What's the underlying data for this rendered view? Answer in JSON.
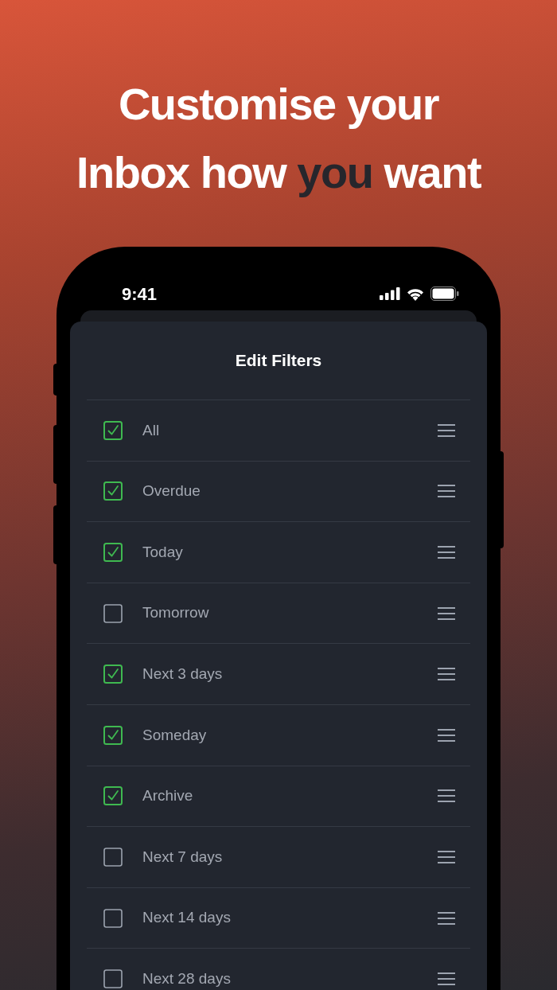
{
  "headline": {
    "line_1": "Customise your",
    "line_2": [
      {
        "text": "Inbox how ",
        "highlight": false
      },
      {
        "text": "you",
        "highlight": true
      },
      {
        "text": " want",
        "highlight": false
      }
    ]
  },
  "status_bar": {
    "time": "9:41"
  },
  "sheet": {
    "title": "Edit Filters"
  },
  "filters": [
    {
      "label": "All",
      "checked": true
    },
    {
      "label": "Overdue",
      "checked": true
    },
    {
      "label": "Today",
      "checked": true
    },
    {
      "label": "Tomorrow",
      "checked": false
    },
    {
      "label": "Next 3 days",
      "checked": true
    },
    {
      "label": "Someday",
      "checked": true
    },
    {
      "label": "Archive",
      "checked": true
    },
    {
      "label": "Next 7 days",
      "checked": false
    },
    {
      "label": "Next 14 days",
      "checked": false
    },
    {
      "label": "Next 28 days",
      "checked": false
    }
  ]
}
